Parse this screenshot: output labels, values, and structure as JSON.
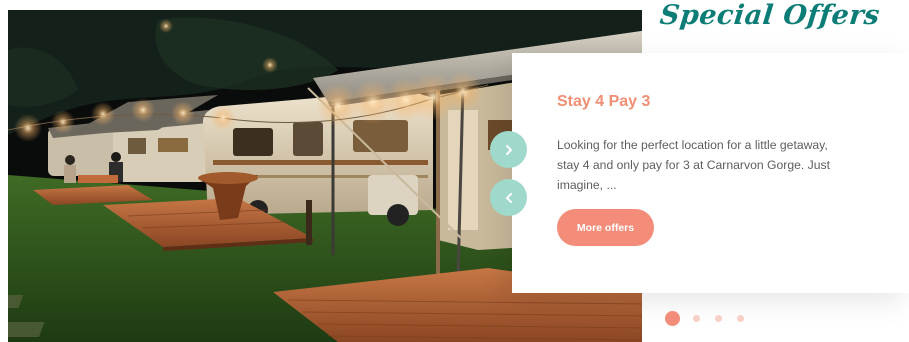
{
  "section": {
    "title": "Special Offers"
  },
  "offer": {
    "title": "Stay 4 Pay 3",
    "description": "Looking for the perfect location for a little getaway, stay 4 and only pay for 3 at Carnarvon Gorge. Just imagine, ...",
    "button_label": "More offers"
  },
  "carousel": {
    "next_icon": "chevron-right-icon",
    "prev_icon": "chevron-left-icon",
    "slide_count": 4,
    "active_slide": 1
  },
  "colors": {
    "heading": "#0c7d76",
    "accent": "#f38d79",
    "offer_title": "#f08f74",
    "arrow_bg": "#9fd9cb",
    "body_text": "#5e5e5e"
  }
}
